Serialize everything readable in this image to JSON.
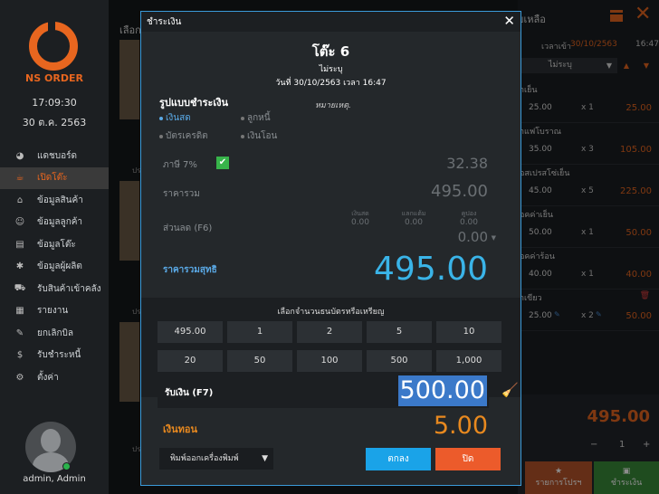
{
  "sidebar": {
    "brand": "NS ORDER",
    "time": "17:09:30",
    "date": "30 ต.ค. 2563",
    "items": [
      {
        "label": "แดชบอร์ด",
        "icon": "dashboard-icon",
        "glyph": "◕"
      },
      {
        "label": "เปิดโต๊ะ",
        "icon": "dish-icon",
        "glyph": "☕"
      },
      {
        "label": "ข้อมูลสินค้า",
        "icon": "basket-icon",
        "glyph": "⌂"
      },
      {
        "label": "ข้อมูลลูกค้า",
        "icon": "customers-icon",
        "glyph": "☺"
      },
      {
        "label": "ข้อมูลโต๊ะ",
        "icon": "table-icon",
        "glyph": "▤"
      },
      {
        "label": "ข้อมูลผู้ผลิต",
        "icon": "supplier-icon",
        "glyph": "✱"
      },
      {
        "label": "รับสินค้าเข้าคลัง",
        "icon": "cart-icon",
        "glyph": "⛟"
      },
      {
        "label": "รายงาน",
        "icon": "report-icon",
        "glyph": "▦"
      },
      {
        "label": "ยกเลิกบิล",
        "icon": "cancel-bill-icon",
        "glyph": "✎"
      },
      {
        "label": "รับชำระหนี้",
        "icon": "coin-icon",
        "glyph": "$"
      },
      {
        "label": "ตั้งค่า",
        "icon": "gear-icon",
        "glyph": "⚙"
      }
    ],
    "active_index": 1,
    "user": "admin, Admin"
  },
  "background": {
    "header": "เลือก",
    "thumb_label": "ปร"
  },
  "order_panel": {
    "title": "ยเหลือ",
    "time_label": "เวลาเข้า",
    "time_date": "30/10/2563",
    "time_clock": "16:47:21",
    "type_select": "ไม่ระบุ",
    "items": [
      {
        "name": "าเย็น",
        "price": "25.00",
        "qty": "x 1",
        "total": "25.00"
      },
      {
        "name": "าแฟโบราณ",
        "price": "35.00",
        "qty": "x 3",
        "total": "105.00"
      },
      {
        "name": "อสเปรสโซ่เย็น",
        "price": "45.00",
        "qty": "x 5",
        "total": "225.00"
      },
      {
        "name": "อคค่าเย็น",
        "price": "50.00",
        "qty": "x 1",
        "total": "50.00"
      },
      {
        "name": "อคค่าร้อน",
        "price": "40.00",
        "qty": "x 1",
        "total": "40.00"
      },
      {
        "name": "าเขียว",
        "price": "25.00",
        "qty": "x 2",
        "total": "50.00"
      }
    ],
    "grand_total": "495.00",
    "qty_value": "1",
    "promo_label": "รายการโปรฯ",
    "pay_label": "ชำระเงิน"
  },
  "modal": {
    "title": "ชำระเงิน",
    "table": "โต๊ะ 6",
    "type": "ไม่ระบุ",
    "datetime": "วันที่ 30/10/2563 เวลา 16:47",
    "pay_method_title": "รูปแบบชำระเงิน",
    "note": "หมายเหตุ.",
    "methods": {
      "cash": "เงินสด",
      "debtor": "ลูกหนี้",
      "credit": "บัตรเครดิต",
      "transfer": "เงินโอน"
    },
    "tax_label": "ภาษี  7%",
    "tax_value": "32.38",
    "total_label": "ราคารวม",
    "total_value": "495.00",
    "discount_label": "ส่วนลด (F6)",
    "disc_cash_label": "เงินสด",
    "disc_cash_value": "0.00",
    "disc_points_label": "แลกแต้ม",
    "disc_points_value": "0.00",
    "disc_coupon_label": "คูปอง",
    "disc_coupon_value": "0.00",
    "discount_value": "0.00",
    "net_label": "ราคารวมสุทธิ",
    "net_value": "495.00",
    "coins_title": "เลือกจำนวนธนบัตรหรือเหรียญ",
    "coins": [
      "495.00",
      "1",
      "2",
      "5",
      "10",
      "20",
      "50",
      "100",
      "500",
      "1,000"
    ],
    "receive_label": "รับเงิน (F7)",
    "receive_value": "500.00",
    "change_label": "เงินทอน",
    "change_value": "5.00",
    "printer_select": "พิมพ์ออกเครื่องพิมพ์",
    "ok_label": "ตกลง",
    "close_label": "ปิด"
  },
  "colors": {
    "accent_orange": "#e8661f",
    "accent_blue": "#3ab4e8",
    "check_green": "#37b44a",
    "close_button": "#ec5b2b",
    "ok_button": "#1aa3e8"
  }
}
